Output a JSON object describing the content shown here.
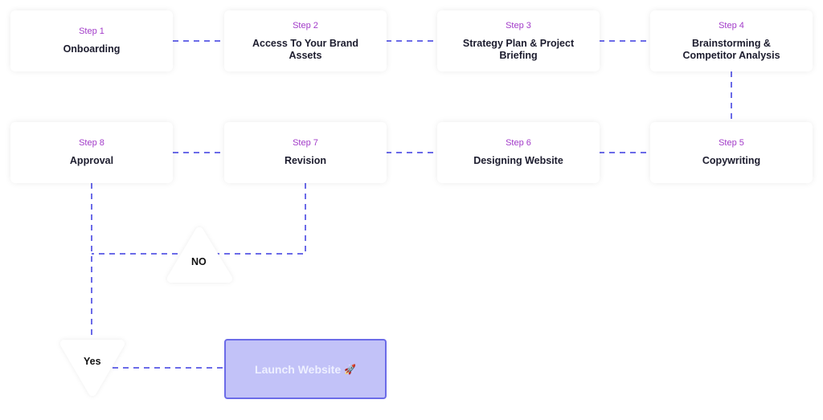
{
  "steps": [
    {
      "step": "Step 1",
      "title": "Onboarding"
    },
    {
      "step": "Step 2",
      "title": "Access To Your Brand Assets"
    },
    {
      "step": "Step 3",
      "title": "Strategy Plan & Project Briefing"
    },
    {
      "step": "Step 4",
      "title": "Brainstorming & Competitor Analysis"
    },
    {
      "step": "Step 5",
      "title": "Copywriting"
    },
    {
      "step": "Step 6",
      "title": "Designing Website"
    },
    {
      "step": "Step 7",
      "title": "Revision"
    },
    {
      "step": "Step 8",
      "title": "Approval"
    }
  ],
  "decision_no": "NO",
  "decision_yes": "Yes",
  "launch": {
    "label": "Launch Website",
    "icon": "rocket-icon",
    "emoji": "🚀"
  },
  "colors": {
    "connector": "#6b6be8",
    "step_label": "#a23bc9",
    "launch_fill": "#c2c2f8"
  }
}
